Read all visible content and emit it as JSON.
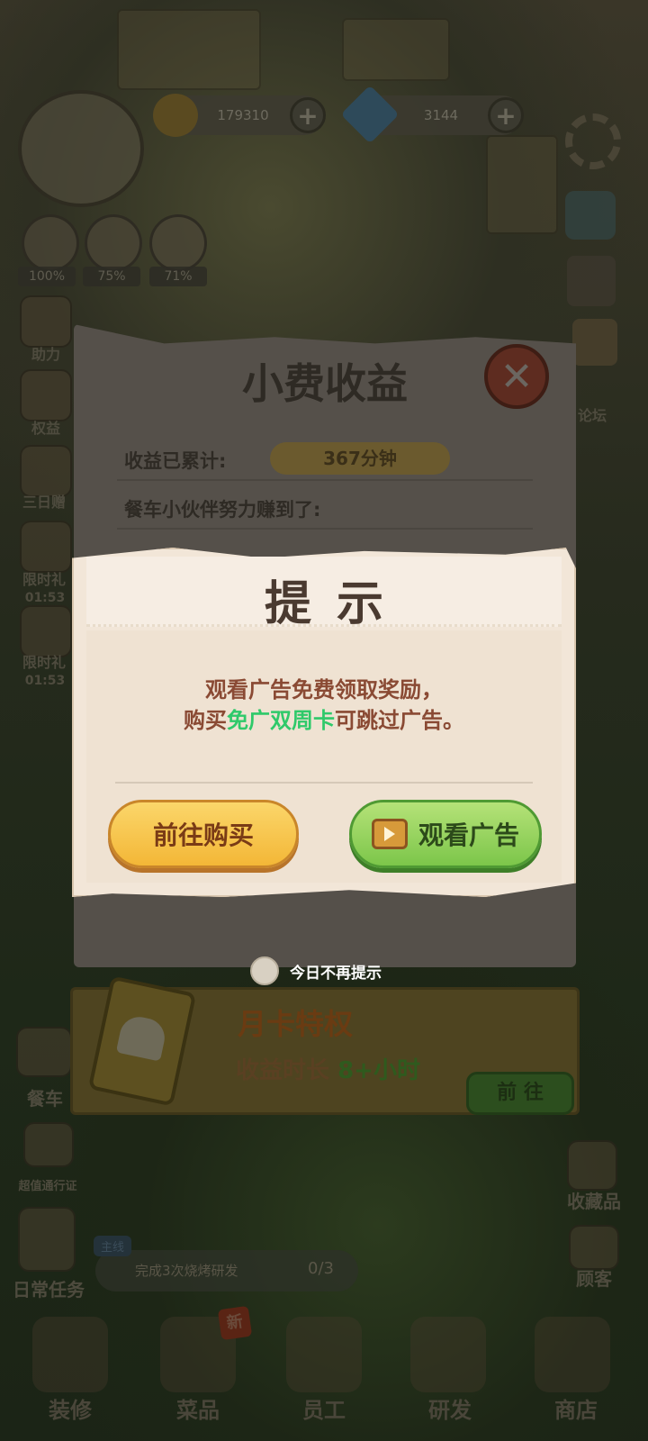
{
  "hud": {
    "coins": "179310",
    "gems": "3144",
    "stats": [
      "100%",
      "75%",
      "71%"
    ]
  },
  "left_menu": {
    "items": [
      "助力",
      "权益",
      "三日赠",
      "限时礼",
      "01:53",
      "限时礼",
      "01:53"
    ],
    "bottom_items": [
      "餐车",
      "超值通行证",
      "日常任务"
    ]
  },
  "right_menu": {
    "items": [
      "论坛",
      "收藏品",
      "顾客"
    ]
  },
  "task": {
    "tag": "主线",
    "text": "完成3次烧烤研发",
    "progress": "0/3"
  },
  "bottom_nav": {
    "items": [
      "装修",
      "菜品",
      "员工",
      "研发",
      "商店"
    ],
    "new_badge": "新"
  },
  "tip_income_dialog": {
    "title": "小费收益",
    "accumulated_label": "收益已累计:",
    "accumulated_value": "367分钟",
    "earned_label": "餐车小伙伴努力赚到了:"
  },
  "monthly_card": {
    "title": "月卡特权",
    "subtitle_prefix": "收益时长 ",
    "subtitle_value": "8+小时",
    "go_label": "前 往"
  },
  "prompt_dialog": {
    "title": "提示",
    "line1": "观看广告免费领取奖励，",
    "line2_prefix": "购买",
    "line2_highlight": "免广双周卡",
    "line2_suffix": "可跳过广告。",
    "buy_label": "前往购买",
    "watch_label": "观看广告"
  },
  "no_remind_label": "今日不再提示"
}
